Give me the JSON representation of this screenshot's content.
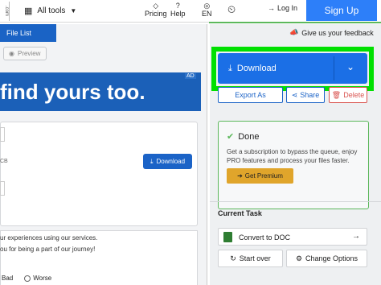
{
  "nav": {
    "logo_stub": ".com",
    "all_tools": "All tools",
    "pricing": "Pricing",
    "help": "Help",
    "language": "EN",
    "login": "Log In",
    "signup": "Sign Up"
  },
  "left": {
    "file_list_tab": "File List",
    "preview": "Preview",
    "ad_text": "find yours too.",
    "ad_tag": "AD",
    "file_size_suffix": "CB",
    "download": "Download",
    "survey_line1": "ur experiences using our services.",
    "survey_line2": "ou for being a part of our journey!",
    "rating_bad": "Bad",
    "rating_worse": "Worse"
  },
  "right": {
    "feedback": "Give us your feedback",
    "download": "Download",
    "export_as": "Export As",
    "share": "Share",
    "delete": "Delete",
    "done_title": "Done",
    "done_text": "Get a subscription to bypass the queue, enjoy PRO features and process your files faster.",
    "get_premium": "Get Premium",
    "current_task": "Current Task",
    "convert_to_doc": "Convert to DOC",
    "start_over": "Start over",
    "change_options": "Change Options"
  },
  "colors": {
    "primary": "#1b6fe6",
    "highlight": "#00e000",
    "success": "#5cb85c",
    "premium": "#e0a52b",
    "danger": "#d9534f"
  }
}
